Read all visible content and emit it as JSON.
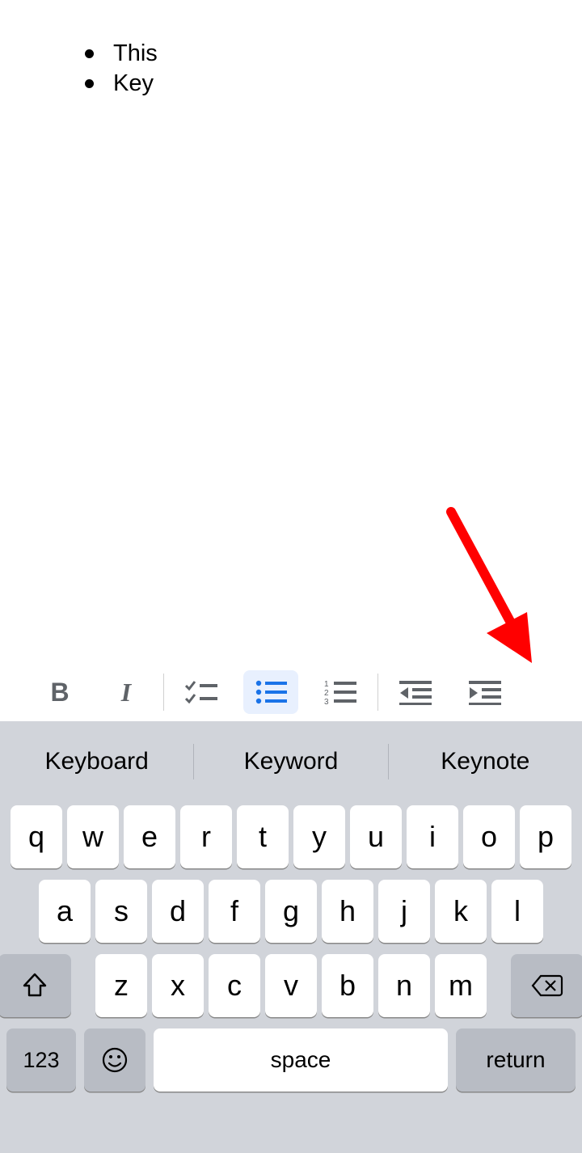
{
  "document": {
    "bullets": [
      "This",
      "Key"
    ]
  },
  "toolbar": {
    "bold_label": "B",
    "italic_label": "I",
    "icons": {
      "bold": "bold-icon",
      "italic": "italic-icon",
      "checklist": "checklist-icon",
      "bulleted_list": "bulleted-list-icon",
      "numbered_list": "numbered-list-icon",
      "indent_decrease": "indent-decrease-icon",
      "indent_increase": "indent-increase-icon"
    },
    "active": "bulleted_list"
  },
  "annotation": {
    "color": "#ff0000",
    "target_icon": "indent-increase-icon"
  },
  "suggestions": [
    "Keyboard",
    "Keyword",
    "Keynote"
  ],
  "keyboard": {
    "row1": [
      "q",
      "w",
      "e",
      "r",
      "t",
      "y",
      "u",
      "i",
      "o",
      "p"
    ],
    "row2": [
      "a",
      "s",
      "d",
      "f",
      "g",
      "h",
      "j",
      "k",
      "l"
    ],
    "row3": [
      "z",
      "x",
      "c",
      "v",
      "b",
      "n",
      "m"
    ],
    "numbers_label": "123",
    "space_label": "space",
    "return_label": "return"
  }
}
